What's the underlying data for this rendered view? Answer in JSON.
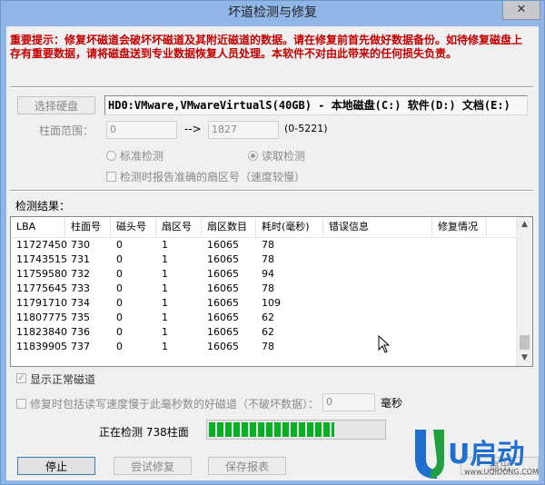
{
  "window": {
    "title": "坏道检测与修复",
    "close_symbol": "✕"
  },
  "warning": "重要提示：修复坏磁道会破坏坏磁道及其附近磁道的数据。请在修复前首先做好数据备份。如待修复磁盘上存有重要数据，请将磁盘送到专业数据恢复人员处理。本软件不对由此带来的任何损失负责。",
  "disk": {
    "select_label": "选择硬盘",
    "info": "HD0:VMware,VMwareVirtualS(40GB) - 本地磁盘(C:) 软件(D:) 文档(E:)"
  },
  "range": {
    "label": "柱面范围：",
    "start": "0",
    "arrow": "-->",
    "end": "1827",
    "total": "(0-5221)"
  },
  "mode": {
    "standard_label": "标准检测",
    "read_label": "读取检测",
    "selected": "read"
  },
  "report_sector": {
    "label": "检测时报告准确的扇区号（速度较慢）"
  },
  "results": {
    "label": "检测结果：",
    "columns": [
      "LBA",
      "柱面号",
      "磁头号",
      "扇区号",
      "扇区数目",
      "耗时(毫秒)",
      "错误信息",
      "修复情况"
    ],
    "rows": [
      [
        "11727450",
        "730",
        "0",
        "1",
        "16065",
        "78",
        "",
        ""
      ],
      [
        "11743515",
        "731",
        "0",
        "1",
        "16065",
        "78",
        "",
        ""
      ],
      [
        "11759580",
        "732",
        "0",
        "1",
        "16065",
        "94",
        "",
        ""
      ],
      [
        "11775645",
        "733",
        "0",
        "1",
        "16065",
        "78",
        "",
        ""
      ],
      [
        "11791710",
        "734",
        "0",
        "1",
        "16065",
        "109",
        "",
        ""
      ],
      [
        "11807775",
        "735",
        "0",
        "1",
        "16065",
        "62",
        "",
        ""
      ],
      [
        "11823840",
        "736",
        "0",
        "1",
        "16065",
        "62",
        "",
        ""
      ],
      [
        "11839905",
        "737",
        "0",
        "1",
        "16065",
        "78",
        "",
        ""
      ]
    ]
  },
  "show_normal": {
    "label": "显示正常磁道",
    "checked": true
  },
  "slow_repair": {
    "label": "修复时包括读写速度慢于此毫秒数的好磁道（不破坏数据）：",
    "value": "0",
    "unit": "毫秒"
  },
  "status": {
    "text": "正在检测  738柱面",
    "progress": 0.72
  },
  "buttons": {
    "stop": "停止",
    "try_repair": "尝试修复",
    "save_report": "保存报表",
    "exit": "退出"
  },
  "logo": {
    "text": "U启动",
    "url": "www.UQIDONG.COM"
  },
  "colors": {
    "warning": "#c40000",
    "progress": "#06b025",
    "frame": "#8fb6e6"
  }
}
